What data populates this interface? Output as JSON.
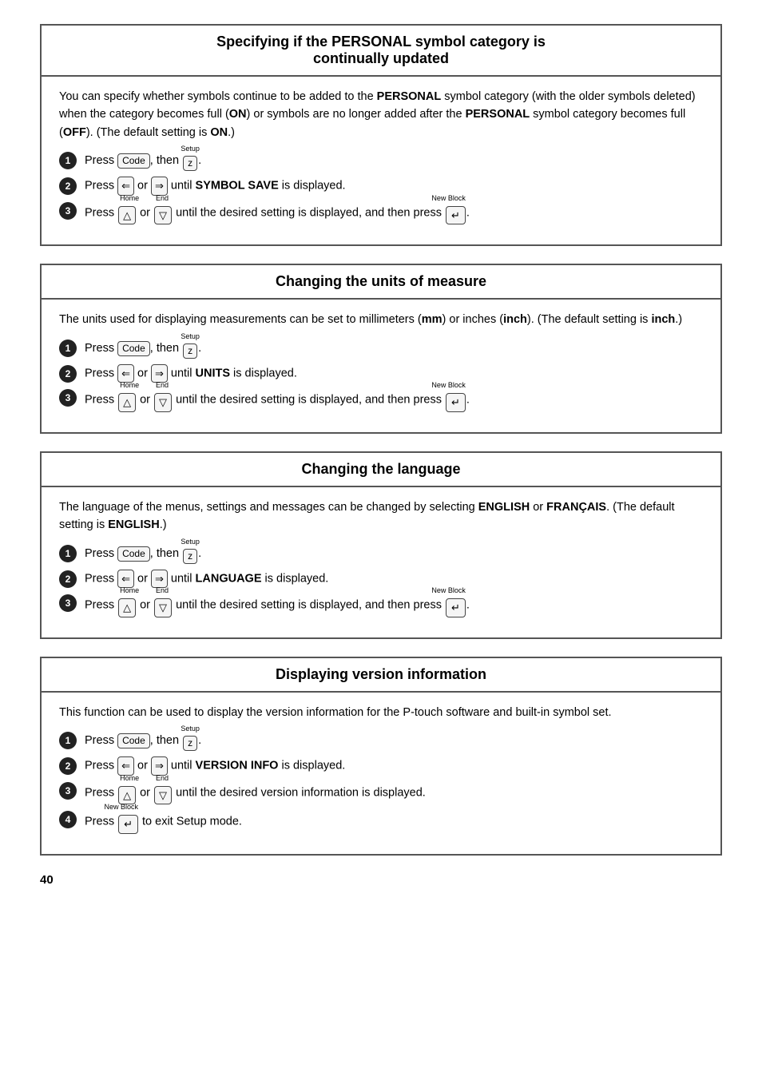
{
  "sections": [
    {
      "id": "personal-symbol",
      "title": "Specifying if the PERSONAL symbol category is continually updated",
      "intro": "You can specify whether symbols continue to be added to the <b>PERSONAL</b> symbol category (with the older symbols deleted) when the category becomes full (<b>ON</b>) or symbols are no longer added after the <b>PERSONAL</b> symbol category becomes full (<b>OFF</b>). (The default setting is <b>ON</b>.)",
      "steps": [
        {
          "num": "1",
          "text": "Press [Code], then [Setup/Z]."
        },
        {
          "num": "2",
          "text": "Press [←] or [→] until <b>SYMBOL SAVE</b> is displayed."
        },
        {
          "num": "3",
          "text": "Press [Home↑] or [End↓] until the desired setting is displayed, and then press [NewBlock↵]."
        }
      ]
    },
    {
      "id": "units-of-measure",
      "title": "Changing the units of measure",
      "intro": "The units used for displaying measurements can be set to millimeters (<b>mm</b>) or inches (<b>inch</b>). (The default setting is <b>inch</b>.)",
      "steps": [
        {
          "num": "1",
          "text": "Press [Code], then [Setup/Z]."
        },
        {
          "num": "2",
          "text": "Press [←] or [→] until <b>UNITS</b> is displayed."
        },
        {
          "num": "3",
          "text": "Press [Home↑] or [End↓] until the desired setting is displayed, and then press [NewBlock↵]."
        }
      ]
    },
    {
      "id": "changing-language",
      "title": "Changing the language",
      "intro": "The language of the menus, settings and messages can be changed by selecting <b>ENGLISH</b> or <b>FRANÇAIS</b>. (The default setting is <b>ENGLISH</b>.)",
      "steps": [
        {
          "num": "1",
          "text": "Press [Code], then [Setup/Z]."
        },
        {
          "num": "2",
          "text": "Press [←] or [→] until <b>LANGUAGE</b> is displayed."
        },
        {
          "num": "3",
          "text": "Press [Home↑] or [End↓] until the desired setting is displayed, and then press [NewBlock↵]."
        }
      ]
    },
    {
      "id": "version-info",
      "title": "Displaying version information",
      "intro": "This function can be used to display the version information for the P-touch software and built-in symbol set.",
      "steps": [
        {
          "num": "1",
          "text": "Press [Code], then [Setup/Z]."
        },
        {
          "num": "2",
          "text": "Press [←] or [→] until <b>VERSION INFO</b> is displayed."
        },
        {
          "num": "3",
          "text": "Press [Home↑] or [End↓] until the desired version information is displayed."
        },
        {
          "num": "4",
          "text": "Press [NewBlock↵] to exit Setup mode."
        }
      ]
    }
  ],
  "page_number": "40",
  "labels": {
    "code_key": "Code",
    "setup_z_super": "Setup",
    "setup_z_key": "z",
    "left_arrow": "◁",
    "right_arrow": "▷",
    "home_super": "Home",
    "home_key": "△",
    "end_super": "End",
    "end_key": "▽",
    "newblock_super": "New Block",
    "newblock_key": "↵",
    "symbol_save": "SYMBOL SAVE",
    "units": "UNITS",
    "language": "LANGUAGE",
    "version_info": "VERSION INFO"
  }
}
